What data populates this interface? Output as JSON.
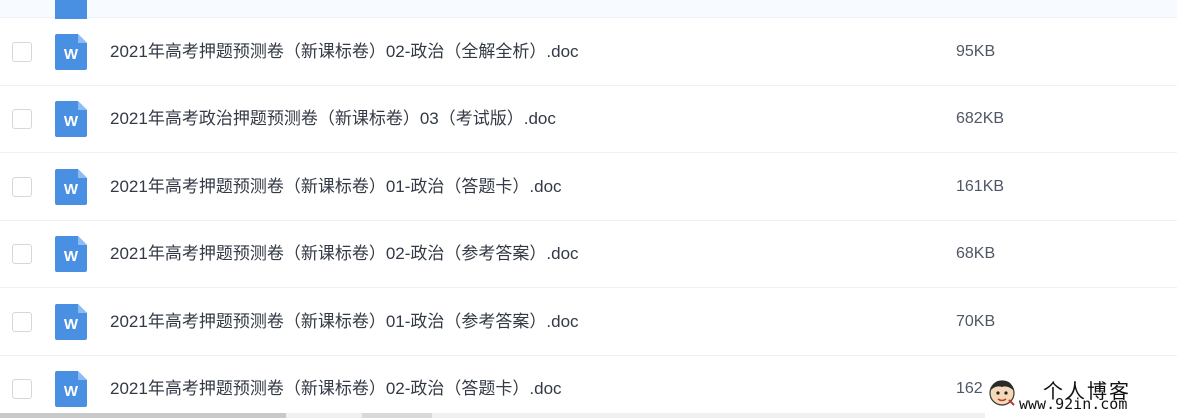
{
  "icons": {
    "file_icon": "word-doc-icon",
    "file_icon_letter": "W",
    "file_icon_color": "#4a90e2"
  },
  "files": [
    {
      "name": "2021年高考押题预测卷（新课标卷）02-政治（全解全析）.doc",
      "size": "95KB"
    },
    {
      "name": "2021年高考政治押题预测卷（新课标卷）03（考试版）.doc",
      "size": "682KB"
    },
    {
      "name": "2021年高考押题预测卷（新课标卷）01-政治（答题卡）.doc",
      "size": "161KB"
    },
    {
      "name": "2021年高考押题预测卷（新课标卷）02-政治（参考答案）.doc",
      "size": "68KB"
    },
    {
      "name": "2021年高考押题预测卷（新课标卷）01-政治（参考答案）.doc",
      "size": "70KB"
    },
    {
      "name": "2021年高考押题预测卷（新课标卷）02-政治（答题卡）.doc",
      "size": "162KB"
    }
  ],
  "watermark": {
    "title": "个人博客",
    "url": "www.92in.com"
  }
}
